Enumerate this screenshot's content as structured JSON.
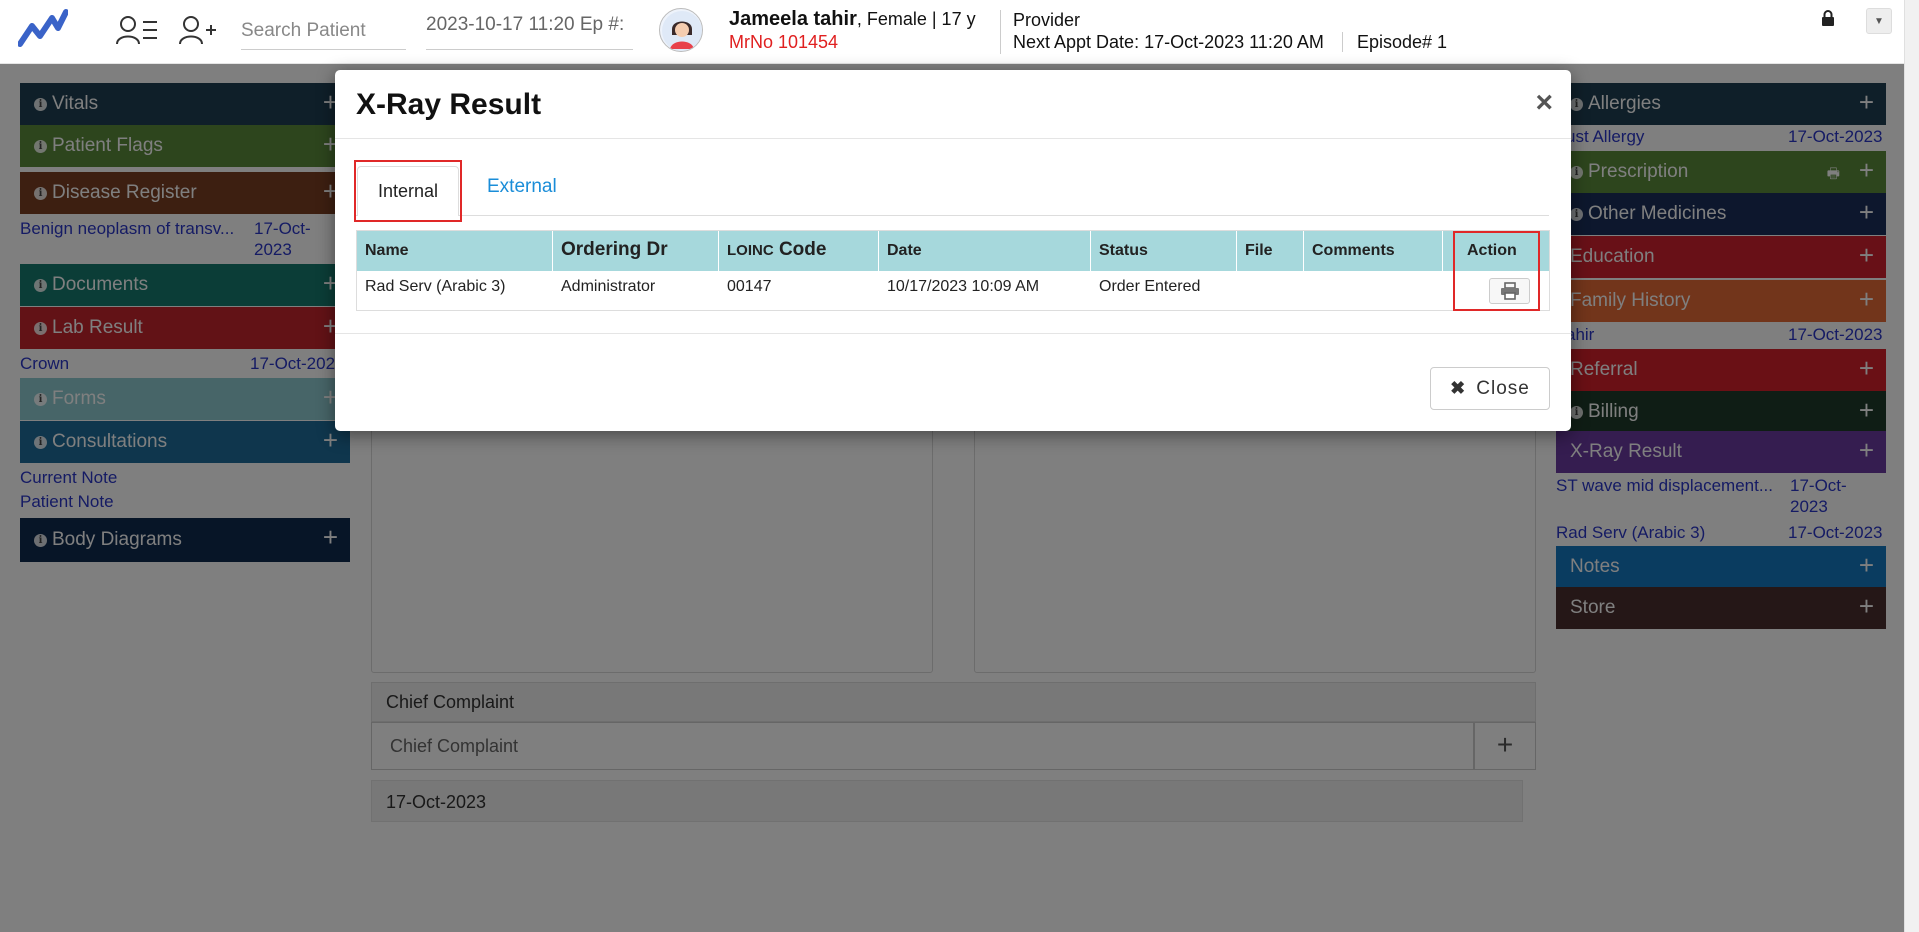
{
  "header": {
    "search_placeholder": "Search Patient",
    "datetime": "2023-10-17 11:20 Ep #:",
    "patient_name": "Jameela tahir",
    "patient_meta": ", Female | 17 y",
    "mrno": "MrNo 101454",
    "provider_label": "Provider",
    "next_appt_label": "Next Appt Date",
    "next_appt_value": ": 17-Oct-2023 11:20 AM",
    "episode": "Episode# 1"
  },
  "left_panels": [
    {
      "label": "Vitals",
      "color": "#1f3f52"
    },
    {
      "label": "Patient Flags",
      "color": "#5a8a3a"
    },
    {
      "label": "Disease Register",
      "color": "#7a3e22"
    },
    {
      "label": "Documents",
      "color": "#167a6e"
    },
    {
      "label": "Lab Result",
      "color": "#c4242c"
    },
    {
      "label": "Forms",
      "color": "#8ecbd0"
    },
    {
      "label": "Consultations",
      "color": "#1f6d9a"
    },
    {
      "label": "Body Diagrams",
      "color": "#0f2a4f"
    }
  ],
  "left_links": {
    "disease_item": "Benign neoplasm of transv...",
    "disease_date_1": "17-Oct-",
    "disease_date_2": "2023",
    "lab_item": "Crown",
    "lab_date": "17-Oct-202",
    "current_note": "Current Note",
    "patient_note": "Patient Note"
  },
  "right_panels": [
    {
      "label": "Allergies",
      "color": "#1f3f52"
    },
    {
      "label": "Prescription",
      "color": "#5a8a3a"
    },
    {
      "label": "Other Medicines",
      "color": "#1a2f5a"
    },
    {
      "label": "Education",
      "color": "#d1202e"
    },
    {
      "label": "Family History",
      "color": "#e56a36"
    },
    {
      "label": "Referral",
      "color": "#d4202a"
    },
    {
      "label": "Billing",
      "color": "#1f3a2a"
    },
    {
      "label": "X-Ray Result",
      "color": "#6a3aa0"
    },
    {
      "label": "Notes",
      "color": "#1478c0"
    },
    {
      "label": "Store",
      "color": "#4a2e2e"
    }
  ],
  "right_links": {
    "allergy_item": "ust Allergy",
    "allergy_date": "17-Oct-2023",
    "family_item": "ahir",
    "family_date": "17-Oct-2023",
    "xray_item_1": "ST wave mid displacement...",
    "xray_date_1a": "17-Oct-",
    "xray_date_1b": "2023",
    "xray_item_2": "Rad Serv (Arabic 3)",
    "xray_date_2": "17-Oct-2023"
  },
  "center": {
    "chief_complaint_label": "Chief Complaint",
    "chief_complaint_placeholder": "Chief Complaint",
    "date": "17-Oct-2023"
  },
  "modal": {
    "title": "X-Ray Result",
    "tabs": {
      "internal": "Internal",
      "external": "External"
    },
    "columns": {
      "name": "Name",
      "ordering_dr": "Ordering Dr",
      "loinc_prefix": "LOINC",
      "loinc_suffix": " Code",
      "date": "Date",
      "status": "Status",
      "file": "File",
      "comments": "Comments",
      "action": "Action"
    },
    "row": {
      "name": "Rad Serv (Arabic 3)",
      "ordering_dr": "Administrator",
      "loinc": "00147",
      "date": "10/17/2023 10:09 AM",
      "status": "Order Entered",
      "file": "",
      "comments": ""
    },
    "close_label": "Close"
  },
  "colors": {
    "table_header": "#a6d8dc",
    "highlight": "#e02828",
    "link": "#2a36c8",
    "tab_link": "#1a8dd8"
  }
}
